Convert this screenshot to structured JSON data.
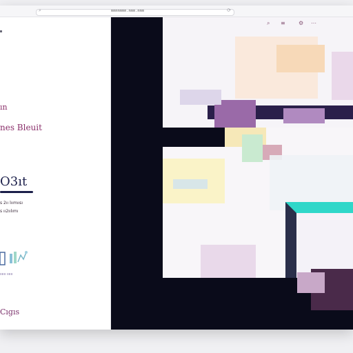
{
  "browser": {
    "url": "mmmmmmm.mmm.mmm"
  },
  "toolbar": {
    "icons": [
      "search-icon",
      "menu-icon",
      "settings-icon",
      "dots-icon"
    ]
  },
  "sidebar": {
    "line_1": "ın",
    "line_2": "nes Bleuit",
    "heading": "O3ıt",
    "desc_1": "s 2ıı lıımıısı",
    "desc_2": "s ıı2ıılımı",
    "caption": "ıııııı ıııııı",
    "footer": "Cıgıs"
  },
  "colors": {
    "accent": "#8a2f6a",
    "dark": "#0a0b1a",
    "teal": "#2fd7c9",
    "heading": "#1b1f4a"
  }
}
